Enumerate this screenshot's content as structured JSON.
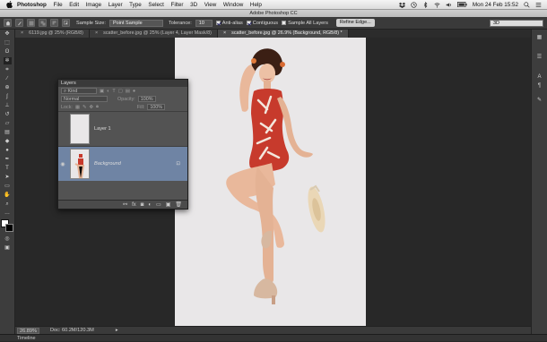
{
  "menubar": {
    "app": "Photoshop",
    "items": [
      "File",
      "Edit",
      "Image",
      "Layer",
      "Type",
      "Select",
      "Filter",
      "3D",
      "View",
      "Window",
      "Help"
    ],
    "datetime": "Mon 24 Feb  15:52"
  },
  "window": {
    "title": "Adobe Photoshop CC"
  },
  "options": {
    "sample_size_label": "Sample Size:",
    "sample_size_value": "Point Sample",
    "tolerance_label": "Tolerance:",
    "tolerance_value": "10",
    "anti_alias": "Anti-alias",
    "contiguous": "Contiguous",
    "sample_all": "Sample All Layers",
    "refine_edge": "Refine Edge...",
    "workspace": "3D"
  },
  "tabs": [
    {
      "label": "6119.jpg @ 25% (RGB/8)",
      "active": false
    },
    {
      "label": "scatter_before.jpg @ 25% (Layer 4, Layer Mask/8)",
      "active": false
    },
    {
      "label": "scatter_before.jpg @ 26.9% (Background, RGB/8) *",
      "active": true
    }
  ],
  "layers_panel": {
    "title": "Layers",
    "filter": "Kind",
    "blend_mode": "Normal",
    "opacity_label": "Opacity:",
    "opacity_value": "100%",
    "lock_label": "Lock:",
    "fill_label": "Fill:",
    "fill_value": "100%",
    "layers": [
      {
        "name": "Layer 1",
        "selected": false
      },
      {
        "name": "Background",
        "selected": true
      }
    ]
  },
  "status": {
    "zoom": "26.89%",
    "doc": "Doc: 60.2M/120.3M"
  },
  "timeline": {
    "label": "Timeline"
  },
  "colors": {
    "selected_layer": "#6f84a4",
    "ui_dark": "#282828",
    "panel": "#535353",
    "canvas_bg": "#e9e7e8",
    "swimsuit": "#c73a2c"
  }
}
